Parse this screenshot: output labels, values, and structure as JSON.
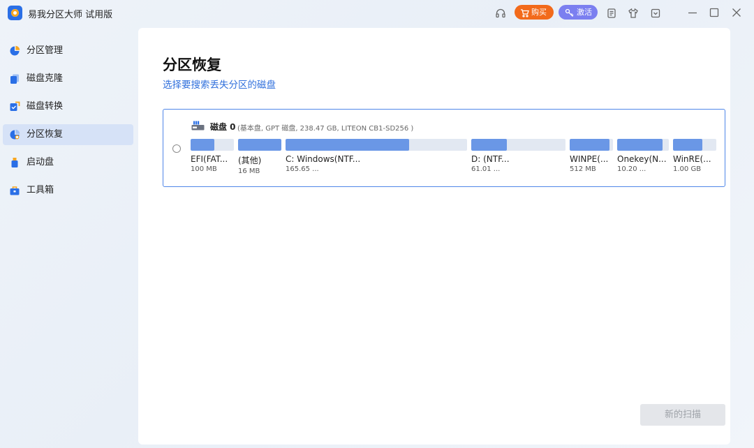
{
  "app": {
    "title": "易我分区大师 试用版"
  },
  "toolbar": {
    "buy_label": "购买",
    "activate_label": "激活"
  },
  "sidebar": {
    "items": [
      {
        "label": "分区管理",
        "icon": "pie-chart-icon"
      },
      {
        "label": "磁盘克隆",
        "icon": "clone-icon"
      },
      {
        "label": "磁盘转换",
        "icon": "convert-icon"
      },
      {
        "label": "分区恢复",
        "icon": "recovery-icon",
        "active": true
      },
      {
        "label": "启动盘",
        "icon": "usb-icon"
      },
      {
        "label": "工具箱",
        "icon": "toolbox-icon"
      }
    ]
  },
  "main": {
    "title": "分区恢复",
    "subtitle": "选择要搜索丢失分区的磁盘",
    "disk": {
      "name": "磁盘 0",
      "info": "(基本盘, GPT 磁盘, 238.47 GB, LITEON CB1-SD256 )",
      "partitions": [
        {
          "label": "EFI(FAT...",
          "size": "100 MB",
          "fill": 0.55
        },
        {
          "label": "(其他)",
          "size": "16 MB",
          "fill": 1.0
        },
        {
          "label": "C: Windows(NTF...",
          "size": "165.65 ...",
          "fill": 0.68
        },
        {
          "label": "D: (NTF...",
          "size": "61.01 ...",
          "fill": 0.38
        },
        {
          "label": "WINPE(...",
          "size": "512 MB",
          "fill": 0.92
        },
        {
          "label": "Onekey(N...",
          "size": "10.20 ...",
          "fill": 0.88
        },
        {
          "label": "WinRE(...",
          "size": "1.00 GB",
          "fill": 0.68
        }
      ]
    },
    "scan_button": "新的扫描"
  },
  "colors": {
    "accent": "#2f6fdc",
    "bar_fill": "#6a97e6",
    "bar_bg": "#e2e8f2",
    "buy": "#f26a1b",
    "activate": "#7b7ff0"
  }
}
